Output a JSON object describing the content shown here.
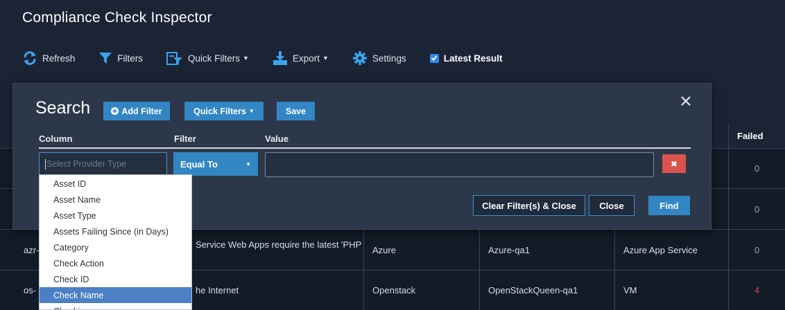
{
  "app": {
    "title": "Compliance Check Inspector"
  },
  "toolbar": {
    "refresh": "Refresh",
    "filters": "Filters",
    "quick_filters": "Quick Filters",
    "export": "Export",
    "settings": "Settings",
    "latest_result": "Latest Result",
    "latest_result_checked": true
  },
  "table": {
    "failed_header": "Failed",
    "rows": [
      {
        "id": "",
        "name": "",
        "provider": "",
        "account": "",
        "asset_type": "",
        "failed": "0"
      },
      {
        "id": "",
        "name": "",
        "provider": "",
        "account": "",
        "asset_type": "",
        "failed": "0"
      },
      {
        "id": "azr-",
        "name": "Service Web Apps require the latest 'PHP",
        "provider": "Azure",
        "account": "Azure-qa1",
        "asset_type": "Azure App Service",
        "failed": "0"
      },
      {
        "id": "os-",
        "name": "he Internet",
        "provider": "Openstack",
        "account": "OpenStackQueen-qa1",
        "asset_type": "VM",
        "failed": "4"
      }
    ]
  },
  "search": {
    "title": "Search",
    "add_filter": "Add Filter",
    "quick_filters": "Quick Filters",
    "save": "Save",
    "column_label": "Column",
    "filter_label": "Filter",
    "value_label": "Value",
    "column_placeholder": "Select Provider Type",
    "filter_value": "Equal To",
    "value_placeholder": "",
    "clear_close": "Clear Filter(s) & Close",
    "close": "Close",
    "find": "Find"
  },
  "dropdown": {
    "items": [
      "Asset ID",
      "Asset Name",
      "Asset Type",
      "Assets Failing Since (in Days)",
      "Category",
      "Check Action",
      "Check ID",
      "Check Name",
      "Checking..."
    ],
    "selected_index": 7
  },
  "colors": {
    "background": "#1b2434",
    "panel": "#2c3849",
    "accent": "#3286c4",
    "danger": "#d9534f",
    "failed_red": "#e0474c"
  }
}
